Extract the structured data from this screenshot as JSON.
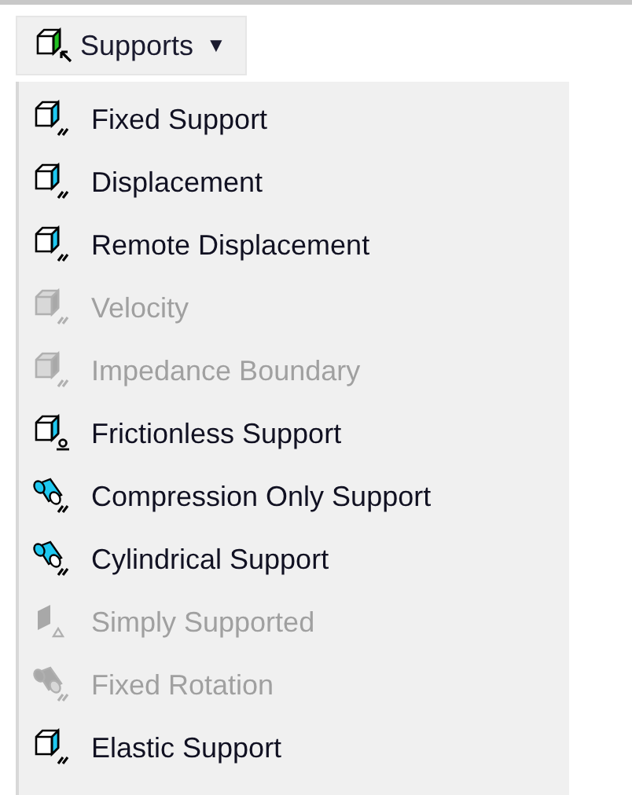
{
  "toolbar_button": {
    "label": "Supports",
    "arrow": "▼"
  },
  "menu_items": [
    {
      "label": "Fixed Support",
      "kind": "cube",
      "disabled": false
    },
    {
      "label": "Displacement",
      "kind": "cube",
      "disabled": false
    },
    {
      "label": "Remote Displacement",
      "kind": "cube",
      "disabled": false
    },
    {
      "label": "Velocity",
      "kind": "cube",
      "disabled": true
    },
    {
      "label": "Impedance Boundary",
      "kind": "cube",
      "disabled": true
    },
    {
      "label": "Frictionless Support",
      "kind": "cube-pin",
      "disabled": false
    },
    {
      "label": "Compression Only Support",
      "kind": "cylinder",
      "disabled": false
    },
    {
      "label": "Cylindrical Support",
      "kind": "cylinder",
      "disabled": false
    },
    {
      "label": "Simply Supported",
      "kind": "plate",
      "disabled": true
    },
    {
      "label": "Fixed Rotation",
      "kind": "cylinder",
      "disabled": true
    },
    {
      "label": "Elastic Support",
      "kind": "cube",
      "disabled": false
    }
  ]
}
